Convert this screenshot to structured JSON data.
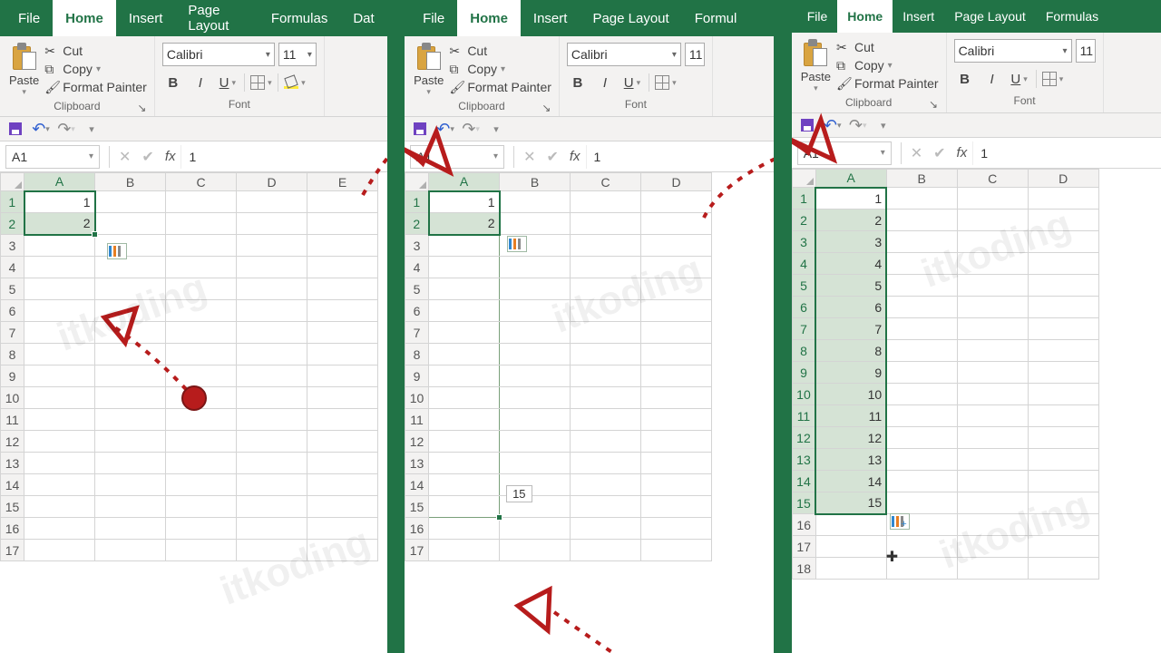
{
  "tabs": {
    "file": "File",
    "home": "Home",
    "insert": "Insert",
    "page_layout": "Page Layout",
    "formulas": "Formulas",
    "data": "Dat",
    "formulas_cut": "Formul",
    "formulas_cut2": "Formulas"
  },
  "clipboard": {
    "paste": "Paste",
    "cut": "Cut",
    "copy": "Copy",
    "format_painter": "Format Painter",
    "group": "Clipboard"
  },
  "font": {
    "name": "Calibri",
    "size": "11",
    "group": "Font",
    "bold": "B",
    "italic": "I",
    "underline": "U"
  },
  "namebox": "A1",
  "fx_value": "1",
  "columns": [
    "A",
    "B",
    "C",
    "D",
    "E"
  ],
  "panel1": {
    "rows": 17,
    "data": {
      "A1": "1",
      "A2": "2"
    }
  },
  "panel2": {
    "rows": 17,
    "data": {
      "A1": "1",
      "A2": "2"
    },
    "drag_tip": "15"
  },
  "panel3": {
    "rows": 18,
    "data": {
      "A1": "1",
      "A2": "2",
      "A3": "3",
      "A4": "4",
      "A5": "5",
      "A6": "6",
      "A7": "7",
      "A8": "8",
      "A9": "9",
      "A10": "10",
      "A11": "11",
      "A12": "12",
      "A13": "13",
      "A14": "14",
      "A15": "15"
    }
  },
  "watermark": "itkoding"
}
